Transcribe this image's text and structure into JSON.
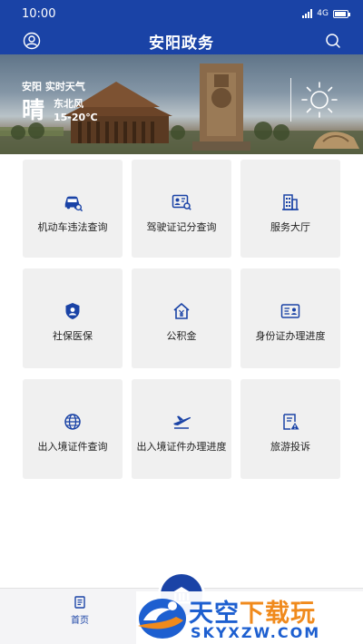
{
  "status_bar": {
    "time": "10:00",
    "network": "4G",
    "battery_level": 0.9
  },
  "header": {
    "title": "安阳政务",
    "profile_icon": "user-icon",
    "search_icon": "search-icon"
  },
  "weather": {
    "city": "安阳",
    "label": "实时天气",
    "condition": "晴",
    "wind": "东北风",
    "temperature": "15-20℃",
    "icon": "sun-icon"
  },
  "services": [
    {
      "label": "机动车违法查询",
      "icon": "car-search-icon"
    },
    {
      "label": "驾驶证记分查询",
      "icon": "license-search-icon"
    },
    {
      "label": "服务大厅",
      "icon": "building-icon"
    },
    {
      "label": "社保医保",
      "icon": "shield-user-icon"
    },
    {
      "label": "公积金",
      "icon": "house-yuan-icon"
    },
    {
      "label": "身份证办理进度",
      "icon": "id-card-icon"
    },
    {
      "label": "出入境证件查询",
      "icon": "globe-icon"
    },
    {
      "label": "出入境证件办理进度",
      "icon": "airplane-icon"
    },
    {
      "label": "旅游投诉",
      "icon": "complaint-doc-icon"
    }
  ],
  "bottom_nav": {
    "home_label": "首页",
    "home_icon": "document-icon",
    "center_icon": "government-building-icon"
  },
  "watermark": {
    "main_a": "天空",
    "main_b": "下载玩",
    "sub": "SKYXZW.COM"
  },
  "colors": {
    "primary": "#1a43a6",
    "card_bg": "#f0f0f0",
    "watermark_blue": "#1d5fd0",
    "watermark_orange": "#f08a1c"
  }
}
